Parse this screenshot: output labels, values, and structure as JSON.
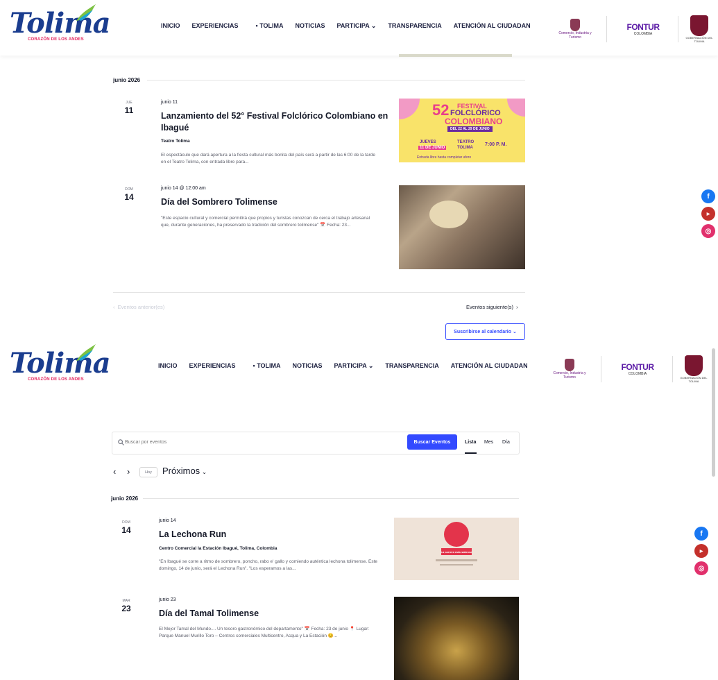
{
  "brand": {
    "name": "Tolima",
    "tagline": "CORAZÓN DE LOS ANDES"
  },
  "nav": [
    "INICIO",
    "EXPERIENCIAS",
    "• TOLIMA",
    "NOTICIAS",
    "PARTICIPA ⌄",
    "TRANSPARENCIA",
    "ATENCIÓN AL CIUDADANO"
  ],
  "partners": {
    "comercio": "Comercio, Industria y Turismo",
    "fontur": "FONTUR",
    "fontur_sub": "COLOMBIA",
    "gobernacion": "GOBERNACIÓN DEL TOLIMA"
  },
  "top": {
    "month": "junio 2026",
    "events": [
      {
        "dow": "JUE",
        "day": "11",
        "date": "junio 11",
        "title": "Lanzamiento del 52° Festival Folclórico Colombiano en Ibagué",
        "venue": "Teatro Tolima",
        "desc": "El espectáculo que dará apertura a la fiesta cultural más bonita del país será a partir de las 6:00 de la tarde en el Teatro Tolima, con entrada libre para..."
      },
      {
        "dow": "DOM",
        "day": "14",
        "date": "junio 14 @ 12:00 am",
        "title": "Día del Sombrero Tolimense",
        "venue": "",
        "desc": "\"Este espacio cultural y comercial permitirá que propios y turistas conozcan de cerca el trabajo artesanal que, durante generaciones, ha preservado la tradición del sombrero tolimense\" 📅 Fecha: 23..."
      }
    ],
    "poster": {
      "num": "52",
      "line1": "FESTIVAL",
      "line2": "FOLCLÓRICO",
      "line3": "COLOMBIANO",
      "range": "DEL 22 AL 29 DE JUNIO",
      "day": "JUEVES",
      "date": "11 DE JUNIO",
      "place1": "TEATRO",
      "place2": "TOLIMA",
      "time": "7:00 P. M.",
      "foot": "Entrada libre hasta completar aforo"
    },
    "prev": "Eventos anterior(es)",
    "next": "Eventos siguiente(s)",
    "subscribe": "Suscribirse al calendario"
  },
  "bottom": {
    "search_placeholder": "Buscar por eventos",
    "search_button": "Buscar Eventos",
    "views": [
      "Lista",
      "Mes",
      "Día"
    ],
    "today": "Hoy",
    "upcoming": "Próximos",
    "month": "junio 2026",
    "events": [
      {
        "dow": "DOM",
        "day": "14",
        "date": "junio 14",
        "title": "La Lechona Run",
        "venue": "Centro Comercial la Estación Ibagué, Tolima, Colombia",
        "desc": "\"En Ibagué se corre a ritmo de sombrero, poncho, rabo e' gallo y comiendo auténtica lechona tolimense. Este domingo, 14 de junio, será el Lechona Run\". \"Los esperamos a las..."
      },
      {
        "dow": "MAR",
        "day": "23",
        "date": "junio 23",
        "title": "Día del Tamal Tolimense",
        "venue": "",
        "desc": "El Mejor Tamal del Mundo.... Un tesoro gastronómico del departamento\" 📅 Fecha: 23 de junio 📍 Lugar: Parque Manuel Murillo Toro – Centros comerciales Multicentro, Acqua y La Estación 😊..."
      }
    ],
    "poster_title": "¡La carrera más sabrosa!"
  },
  "colors": {
    "accent": "#334aff",
    "brand_blue": "#1b3d8f",
    "brand_pink": "#e2245d"
  },
  "social": [
    "facebook-icon",
    "youtube-icon",
    "instagram-icon"
  ]
}
